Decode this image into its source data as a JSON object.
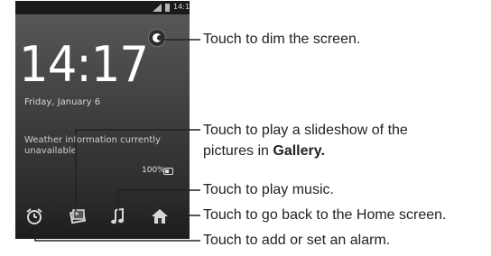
{
  "status_bar": {
    "time": "14:17"
  },
  "lockscreen": {
    "clock": "14:17",
    "date": "Friday, January 6",
    "weather": "Weather information currently unavailable",
    "battery": "100%"
  },
  "dock": {
    "icons": [
      "alarm-icon",
      "gallery-icon",
      "music-icon",
      "home-icon"
    ]
  },
  "callouts": {
    "dim": "Touch to dim the screen.",
    "slideshow_line1": "Touch to play a slideshow of the",
    "slideshow_line2_prefix": "pictures in ",
    "slideshow_line2_bold": "Gallery.",
    "music": "Touch to play music.",
    "home": "Touch to go back to the Home screen.",
    "alarm": "Touch to add or set an alarm."
  }
}
